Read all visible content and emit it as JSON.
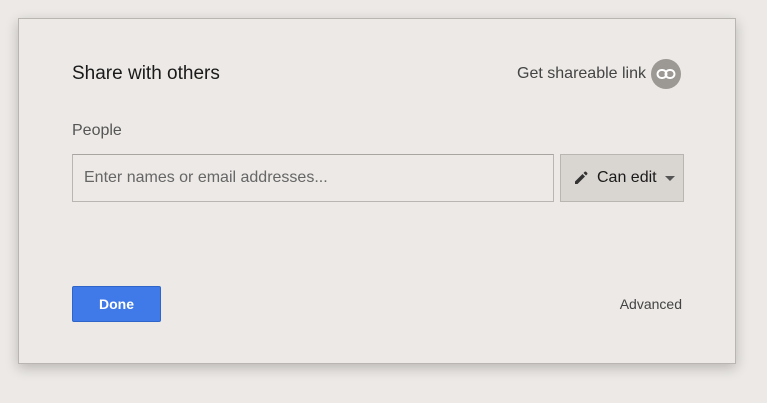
{
  "dialog": {
    "title": "Share with others",
    "shareable_link_label": "Get shareable link",
    "people_label": "People",
    "input_placeholder": "Enter names or email addresses...",
    "permission_label": "Can edit",
    "done_label": "Done",
    "advanced_label": "Advanced"
  },
  "icons": {
    "link": "link-icon",
    "pencil": "pencil-icon",
    "caret": "chevron-down-icon"
  },
  "colors": {
    "primary_button": "#3f7ae8",
    "background": "#ece9e6"
  }
}
